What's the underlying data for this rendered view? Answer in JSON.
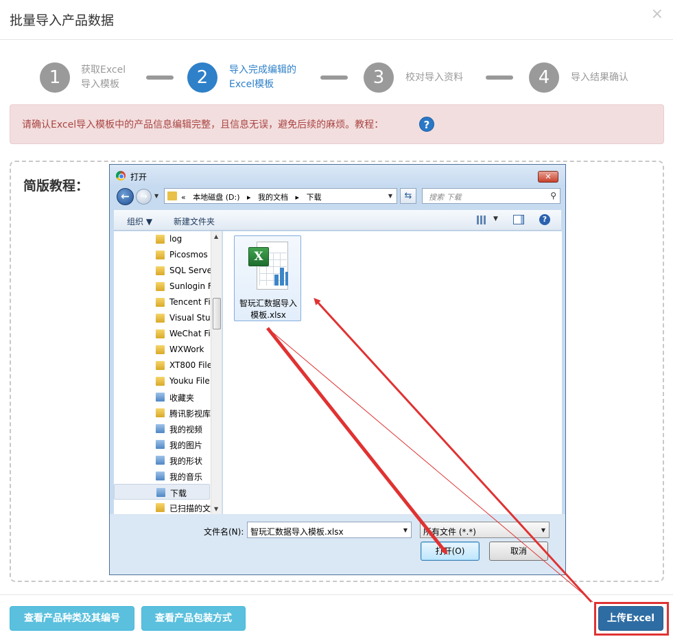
{
  "modal": {
    "title": "批量导入产品数据",
    "close": "×"
  },
  "steps": [
    {
      "number": "1",
      "label_line1": "获取Excel",
      "label_line2": "导入模板",
      "active": false
    },
    {
      "number": "2",
      "label_line1": "导入完成编辑的",
      "label_line2": "Excel模板",
      "active": true
    },
    {
      "number": "3",
      "label_line1": "校对导入资料",
      "label_line2": "",
      "active": false
    },
    {
      "number": "4",
      "label_line1": "导入结果确认",
      "label_line2": "",
      "active": false
    }
  ],
  "alert": {
    "text": "请确认Excel导入模板中的产品信息编辑完整，且信息无误，避免后续的麻烦。教程：",
    "help_icon": "question-circle-icon"
  },
  "tutorial": {
    "title": "简版教程："
  },
  "dialog": {
    "title": "打开",
    "close_glyph": "✕",
    "address": {
      "prefix": "«",
      "crumbs": [
        "本地磁盘 (D:)",
        "我的文档",
        "下载"
      ],
      "separator": "▸"
    },
    "search_placeholder": "搜索 下载",
    "toolbar": {
      "organize": "组织 ▼",
      "new_folder": "新建文件夹"
    },
    "tree": [
      {
        "label": "log",
        "type": "folder"
      },
      {
        "label": "Picosmos",
        "type": "folder"
      },
      {
        "label": "SQL Serve",
        "type": "folder"
      },
      {
        "label": "Sunlogin F",
        "type": "folder"
      },
      {
        "label": "Tencent Fi",
        "type": "folder"
      },
      {
        "label": "Visual Stuc",
        "type": "folder"
      },
      {
        "label": "WeChat Fi",
        "type": "folder"
      },
      {
        "label": "WXWork",
        "type": "folder"
      },
      {
        "label": "XT800 File",
        "type": "folder"
      },
      {
        "label": "Youku File",
        "type": "folder"
      },
      {
        "label": "收藏夹",
        "type": "special"
      },
      {
        "label": "腾讯影视库",
        "type": "folder"
      },
      {
        "label": "我的视频",
        "type": "special"
      },
      {
        "label": "我的图片",
        "type": "special"
      },
      {
        "label": "我的形状",
        "type": "special"
      },
      {
        "label": "我的音乐",
        "type": "special"
      },
      {
        "label": "下载",
        "type": "special",
        "selected": true
      },
      {
        "label": "已扫描的文",
        "type": "folder"
      }
    ],
    "file": {
      "name": "智玩汇数据导入模板.xlsx",
      "name_line1": "智玩汇数据导入",
      "name_line2": "模板.xlsx",
      "icon": "excel-file-icon",
      "badge": "X"
    },
    "filename_label": "文件名(N):",
    "filename_value": "智玩汇数据导入模板.xlsx",
    "filetype_value": "所有文件 (*.*)",
    "open_button": "打开(O)",
    "cancel_button": "取消"
  },
  "footer": {
    "btn_categories": "查看产品种类及其编号",
    "btn_packaging": "查看产品包装方式",
    "btn_upload": "上传Excel"
  },
  "colors": {
    "primary": "#2e80c9",
    "info": "#5bc0de",
    "alert_text": "#a94442",
    "annotation_red": "#e03232"
  }
}
